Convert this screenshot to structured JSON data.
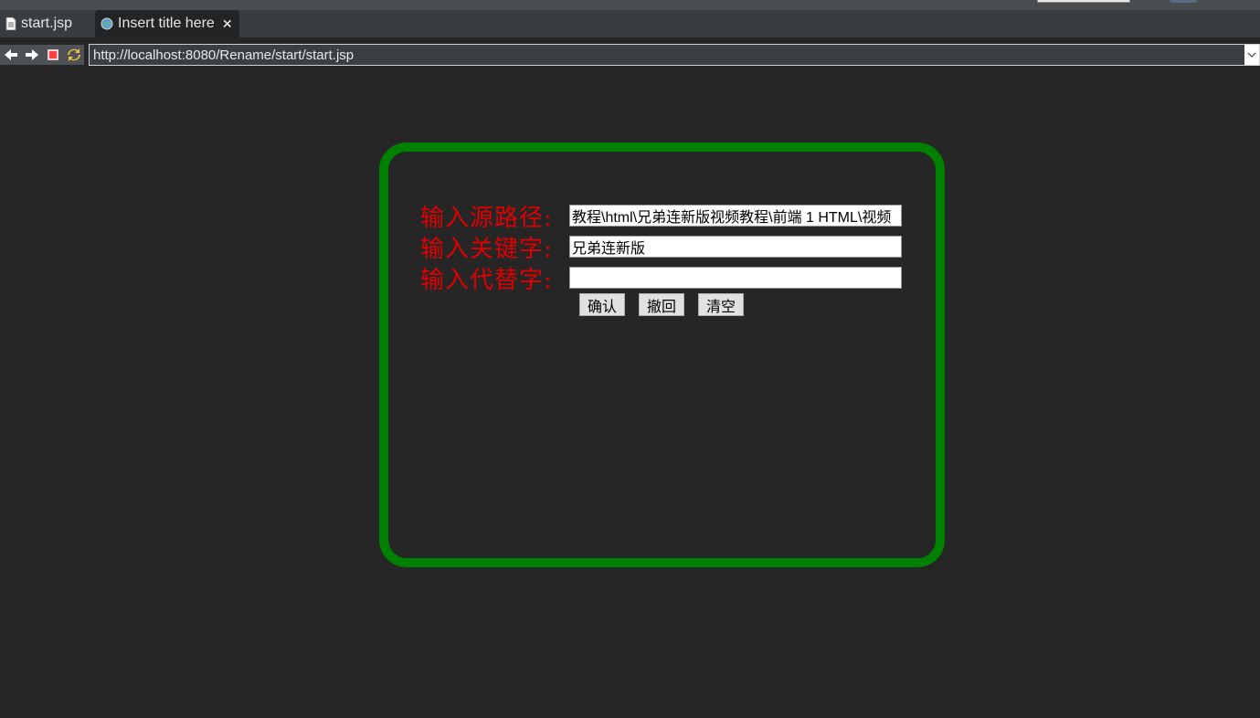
{
  "tabs": [
    {
      "label": "start.jsp",
      "icon": "file-icon",
      "active": false
    },
    {
      "label": "Insert title here",
      "icon": "globe-icon",
      "active": true
    }
  ],
  "nav": {
    "back_icon": "back-arrow-icon",
    "forward_icon": "forward-arrow-icon",
    "stop_icon": "stop-icon",
    "refresh_icon": "refresh-icon",
    "url": "http://localhost:8080/Rename/start/start.jsp"
  },
  "form": {
    "source_label": "输入源路径:",
    "source_value": "教程\\html\\兄弟连新版视频教程\\前端 1 HTML\\视频",
    "keyword_label": "输入关键字:",
    "keyword_value": "兄弟连新版",
    "replace_label": "输入代替字:",
    "replace_value": "",
    "confirm_label": "确认",
    "undo_label": "撤回",
    "clear_label": "清空"
  },
  "colors": {
    "border": "#008000",
    "label": "#e00000",
    "background": "#262626"
  }
}
